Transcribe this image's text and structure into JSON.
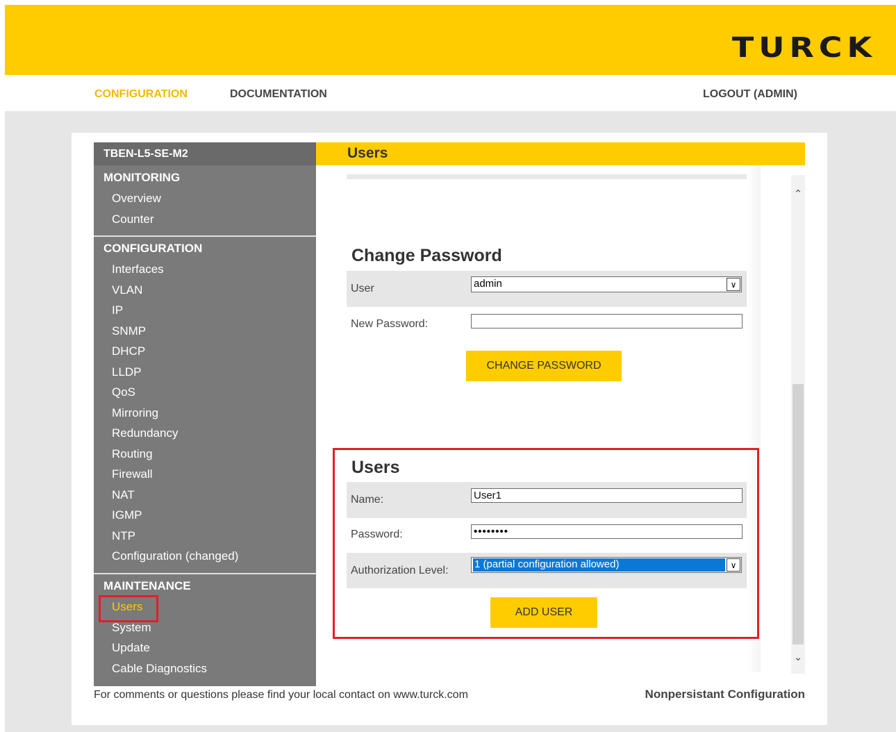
{
  "brand": {
    "logo_text": "TURCK",
    "accent": "#ffcc00"
  },
  "topnav": {
    "configuration": "CONFIGURATION",
    "documentation": "DOCUMENTATION",
    "logout": "LOGOUT (ADMIN)"
  },
  "sidebar": {
    "device": "TBEN-L5-SE-M2",
    "monitoring": {
      "title": "MONITORING",
      "items": [
        "Overview",
        "Counter"
      ]
    },
    "configuration": {
      "title": "CONFIGURATION",
      "items": [
        "Interfaces",
        "VLAN",
        "IP",
        "SNMP",
        "DHCP",
        "LLDP",
        "QoS",
        "Mirroring",
        "Redundancy",
        "Routing",
        "Firewall",
        "NAT",
        "IGMP",
        "NTP",
        "Configuration (changed)"
      ]
    },
    "maintenance": {
      "title": "MAINTENANCE",
      "items": [
        "Users",
        "System",
        "Update",
        "Cable Diagnostics"
      ]
    }
  },
  "page": {
    "title": "Users"
  },
  "change_password": {
    "heading": "Change Password",
    "user_label": "User",
    "user_value": "admin",
    "new_password_label": "New Password:",
    "new_password_value": "",
    "button": "CHANGE PASSWORD"
  },
  "users": {
    "heading": "Users",
    "name_label": "Name:",
    "name_value": "User1",
    "password_label": "Password:",
    "password_value": "••••••••",
    "auth_label": "Authorization Level:",
    "auth_value": "1 (partial configuration allowed)",
    "button": "ADD USER"
  },
  "footer": {
    "contact": "For comments or questions please find your local contact on www.turck.com",
    "status": "Nonpersistant Configuration"
  }
}
